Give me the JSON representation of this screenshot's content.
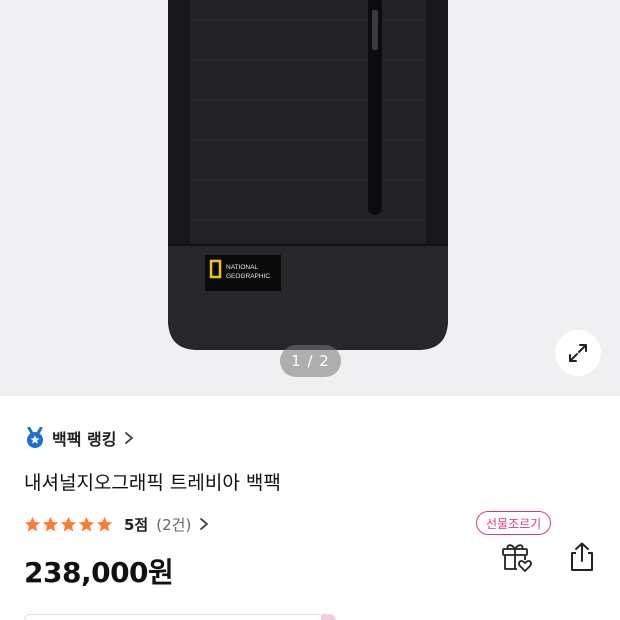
{
  "gallery": {
    "counter": "1 / 2",
    "brand_patch_line1": "NATIONAL",
    "brand_patch_line2": "GEOGRAPHIC"
  },
  "ranking": {
    "label": "백팩 랭킹",
    "icon": "medal-icon"
  },
  "product": {
    "title": "내셔널지오그래픽 트레비아 백팩",
    "rating_stars": 5,
    "score": "5점",
    "review_count": "(2건)",
    "price": "238,000원"
  },
  "actions": {
    "gift_badge": "선물조르기",
    "gift_icon": "gift-heart-icon",
    "share_icon": "share-icon"
  },
  "colors": {
    "star": "#ff7a33",
    "gift_accent": "#d63b8b",
    "ranking_icon": "#1e6fd9"
  }
}
